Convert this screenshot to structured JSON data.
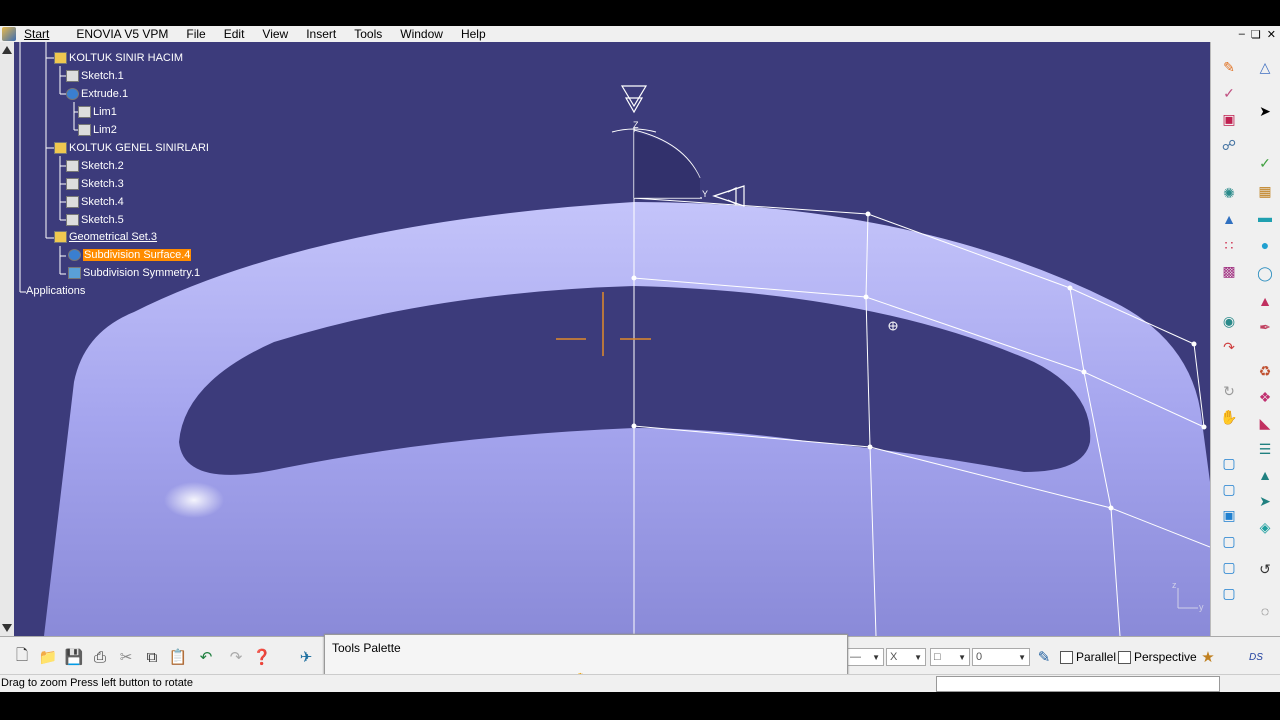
{
  "menu": {
    "start": "Start",
    "items": [
      "ENOVIA V5 VPM",
      "File",
      "Edit",
      "View",
      "Insert",
      "Tools",
      "Window",
      "Help"
    ]
  },
  "tree": {
    "nodes": [
      {
        "label": "KOLTUK SINIR HACIM",
        "kind": "body"
      },
      {
        "label": "Sketch.1",
        "kind": "sketch"
      },
      {
        "label": "Extrude.1",
        "kind": "extrude"
      },
      {
        "label": "Lim1",
        "kind": "lim"
      },
      {
        "label": "Lim2",
        "kind": "lim"
      },
      {
        "label": "KOLTUK GENEL SINIRLARI",
        "kind": "body"
      },
      {
        "label": "Sketch.2",
        "kind": "sketch"
      },
      {
        "label": "Sketch.3",
        "kind": "sketch"
      },
      {
        "label": "Sketch.4",
        "kind": "sketch"
      },
      {
        "label": "Sketch.5",
        "kind": "sketch"
      },
      {
        "label": "Geometrical Set.3",
        "kind": "geoset"
      },
      {
        "label": "Subdivision Surface.4",
        "kind": "subdivision",
        "selected": true
      },
      {
        "label": "Subdivision Symmetry.1",
        "kind": "symmetry"
      },
      {
        "label": "Applications",
        "kind": "root"
      }
    ]
  },
  "compass": {
    "z_label": "Z",
    "y_label": "Y"
  },
  "axis_indicator": {
    "z": "z",
    "y": "y"
  },
  "palette": {
    "title": "Tools Palette"
  },
  "toolbar": {
    "parallel_label": "Parallel",
    "perspective_label": "Perspective",
    "combo_value": "0",
    "x_label": "X"
  },
  "status": {
    "text": "Drag to zoom  Press left button to rotate"
  },
  "colors": {
    "viewport_bg": "#3c3b7b",
    "surface": "#a8a8f2",
    "selection": "#ff8c00"
  }
}
